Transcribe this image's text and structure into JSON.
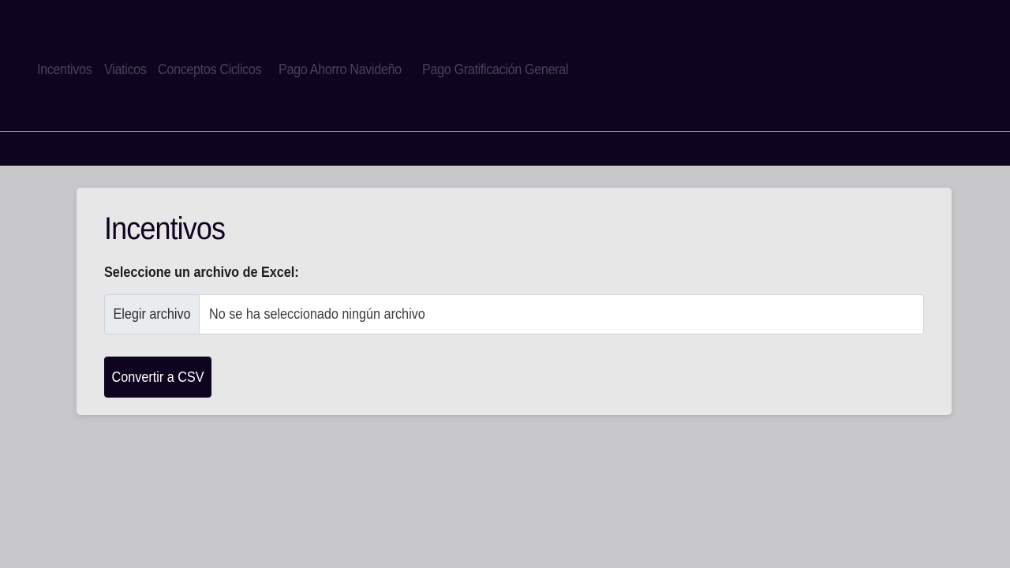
{
  "nav": {
    "items": [
      {
        "label": "Incentivos"
      },
      {
        "label": "Viaticos"
      },
      {
        "label": "Conceptos Ciclicos"
      },
      {
        "label": "Pago Ahorro Navideño"
      },
      {
        "label": "Pago Gratificación General"
      }
    ]
  },
  "main": {
    "title": "Incentivos",
    "file_label": "Seleccione un archivo de Excel:",
    "file_button_label": "Elegir archivo",
    "file_status": "No se ha seleccionado ningún archivo",
    "convert_label": "Convertir a CSV"
  },
  "colors": {
    "header_bg": "#0f0420",
    "page_bg": "#c8c8ca",
    "card_bg": "#e7e7e8",
    "primary": "#0f0420"
  }
}
